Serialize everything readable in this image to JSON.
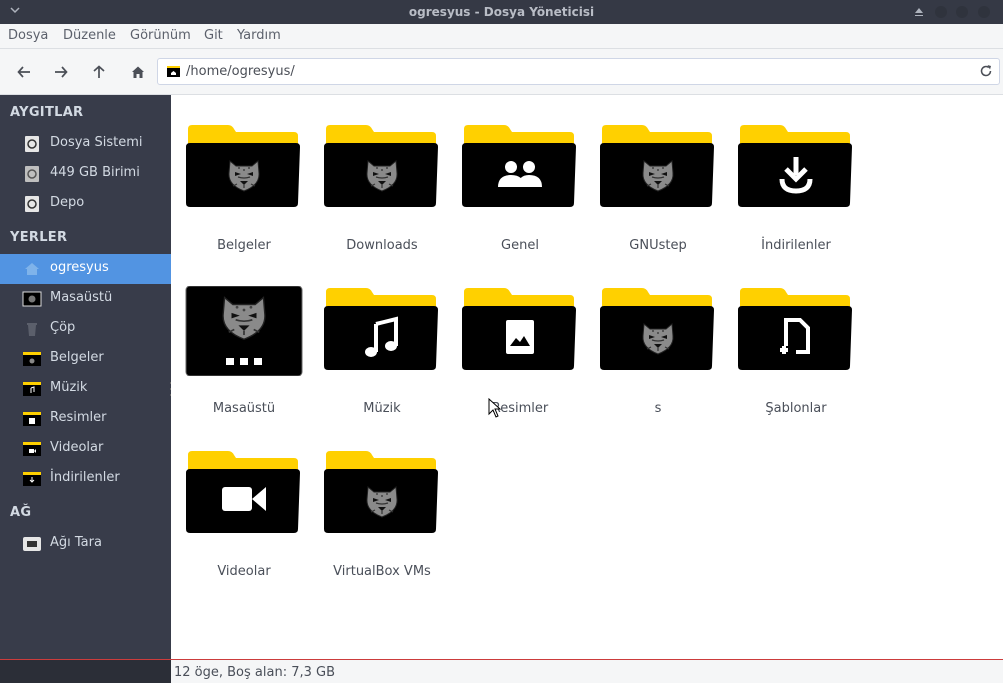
{
  "window": {
    "title": "ogresyus - Dosya Yöneticisi"
  },
  "menubar": {
    "items": [
      "Dosya",
      "Düzenle",
      "Görünüm",
      "Git",
      "Yardım"
    ]
  },
  "toolbar": {
    "back_icon": "arrow-left-icon",
    "forward_icon": "arrow-right-icon",
    "up_icon": "arrow-up-icon",
    "home_icon": "home-icon",
    "location": "/home/ogresyus/",
    "reload_icon": "reload-icon"
  },
  "sidebar": {
    "devices_heading": "AYGITLAR",
    "devices": [
      {
        "label": "Dosya Sistemi",
        "icon": "drive-icon"
      },
      {
        "label": "449 GB Birimi",
        "icon": "drive-icon"
      },
      {
        "label": "Depo",
        "icon": "drive-icon"
      }
    ],
    "places_heading": "YERLER",
    "places": [
      {
        "label": "ogresyus",
        "icon": "home-folder-icon",
        "active": true
      },
      {
        "label": "Masaüstü",
        "icon": "desktop-icon"
      },
      {
        "label": "Çöp",
        "icon": "trash-icon"
      },
      {
        "label": "Belgeler",
        "icon": "folder-documents-icon"
      },
      {
        "label": "Müzik",
        "icon": "folder-music-icon"
      },
      {
        "label": "Resimler",
        "icon": "folder-pictures-icon"
      },
      {
        "label": "Videolar",
        "icon": "folder-videos-icon"
      },
      {
        "label": "İndirilenler",
        "icon": "folder-download-icon"
      }
    ],
    "network_heading": "AĞ",
    "network": [
      {
        "label": "Ağı Tara",
        "icon": "network-icon"
      }
    ]
  },
  "files": [
    {
      "name": "Belgeler",
      "icon": "folder-panther-icon"
    },
    {
      "name": "Downloads",
      "icon": "folder-panther-icon"
    },
    {
      "name": "Genel",
      "icon": "folder-public-icon"
    },
    {
      "name": "GNUstep",
      "icon": "folder-panther-icon"
    },
    {
      "name": "İndirilenler",
      "icon": "folder-download-icon"
    },
    {
      "name": "Masaüstü",
      "icon": "desktop-panther-icon"
    },
    {
      "name": "Müzik",
      "icon": "folder-music-icon"
    },
    {
      "name": "Resimler",
      "icon": "folder-pictures-icon"
    },
    {
      "name": "s",
      "icon": "folder-panther-icon"
    },
    {
      "name": "Şablonlar",
      "icon": "folder-templates-icon"
    },
    {
      "name": "Videolar",
      "icon": "folder-videos-icon"
    },
    {
      "name": "VirtualBox VMs",
      "icon": "folder-panther-icon"
    }
  ],
  "statusbar": {
    "text": "12 öge, Boş alan: 7,3 GB"
  },
  "colors": {
    "folder_yellow": "#ffd000",
    "folder_black": "#000000",
    "sidebar_bg": "#383c4a",
    "selection_blue": "#5294e2",
    "titlebar_bg": "#353945"
  }
}
